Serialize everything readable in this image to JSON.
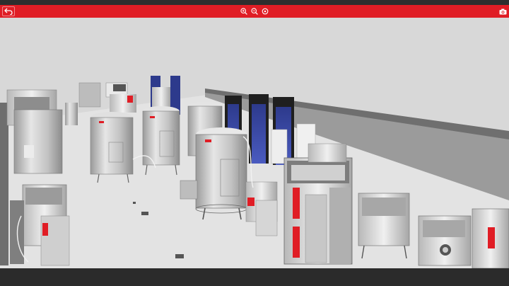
{
  "app": {
    "toolbar_color": "#e01d25",
    "chrome_color": "#2b2b2b"
  },
  "toolbar": {
    "buttons": [
      {
        "icon": "back-arrow-icon"
      },
      {
        "icon": "zoom-in-icon"
      },
      {
        "icon": "zoom-out-icon"
      },
      {
        "icon": "reset-view-icon"
      },
      {
        "icon": "camera-icon"
      }
    ]
  },
  "scene": {
    "description_icon": "3d-bioprocess-facility-view"
  }
}
